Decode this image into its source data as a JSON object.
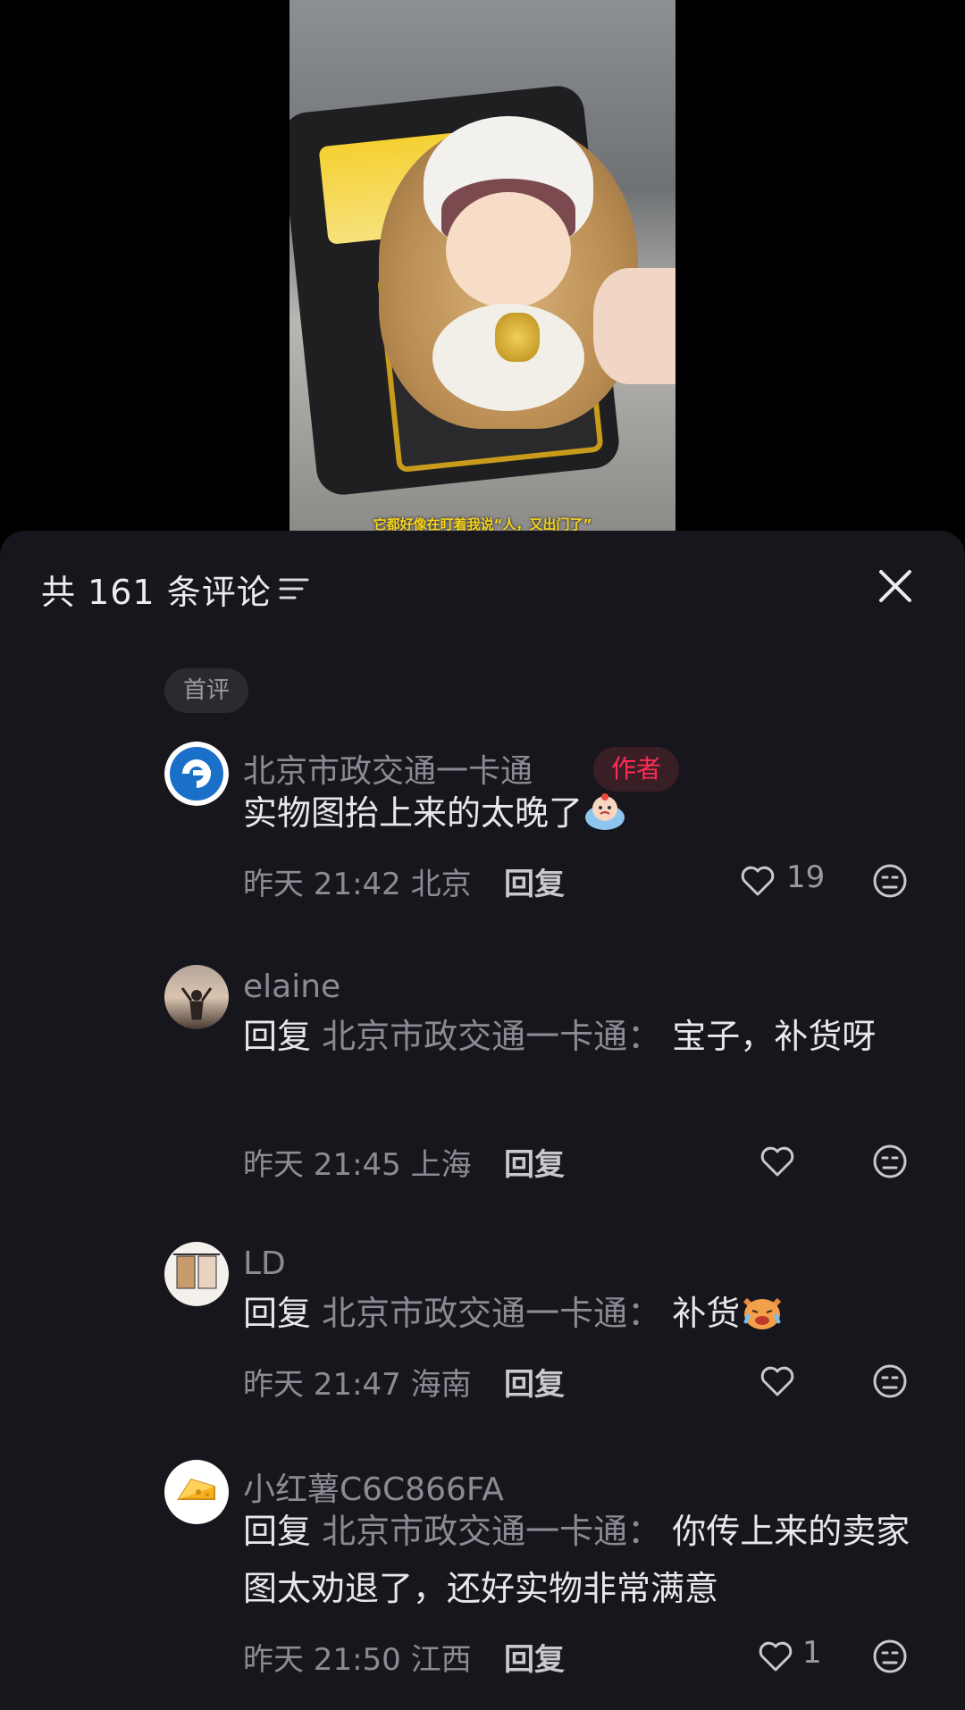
{
  "video": {
    "caption": "它都好像在盯着我说“人，又出门了”"
  },
  "sheet": {
    "count_label": "共 161 条评论"
  },
  "first_badge": "首评",
  "comments": [
    {
      "username": "北京市政交通一卡通",
      "tag": "作者",
      "text": "实物图抬上来的太晚了",
      "emoji": "crying-face-emoji",
      "time": "昨天 21:42",
      "location": "北京",
      "reply_label": "回复",
      "likes": "19"
    },
    {
      "username": "elaine",
      "reply_prefix": "回复",
      "reply_target": "北京市政交通一卡通：",
      "text": "宝子，补货呀",
      "time": "昨天 21:45",
      "location": "上海",
      "reply_label": "回复",
      "likes": ""
    },
    {
      "username": "LD",
      "reply_prefix": "回复",
      "reply_target": "北京市政交通一卡通：",
      "text": "补货",
      "emoji": "crying-cat-emoji",
      "time": "昨天 21:47",
      "location": "海南",
      "reply_label": "回复",
      "likes": ""
    },
    {
      "username": "小红薯C6C866FA",
      "reply_prefix": "回复",
      "reply_target": "北京市政交通一卡通：",
      "text": "你传上来的卖家图太劝退了，还好实物非常满意",
      "time": "昨天 21:50",
      "location": "江西",
      "reply_label": "回复",
      "likes": "1"
    }
  ],
  "colors": {
    "background": "#16161c",
    "accent": "#fe2c55",
    "muted_text": "#8b8b93"
  }
}
